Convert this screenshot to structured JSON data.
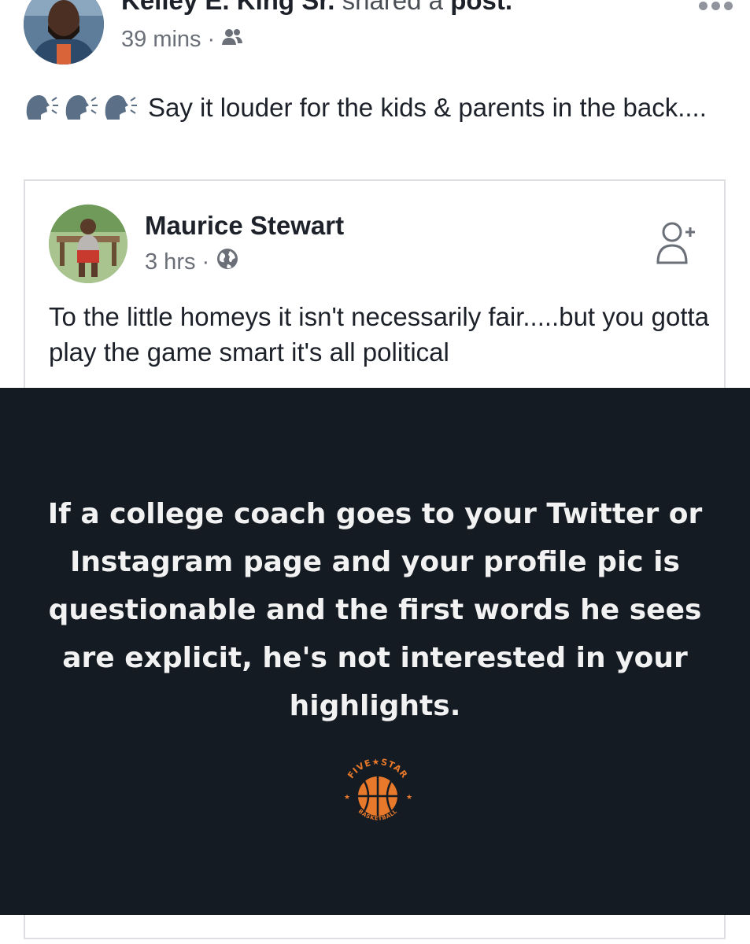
{
  "outer_post": {
    "author": "Kelley E. King Sr.",
    "verb": " shared a ",
    "object": "post.",
    "time": "39 mins",
    "separator": "·",
    "audience_icon": "friends-icon",
    "menu_icon": "more-dots-icon",
    "text": "Say it louder for the kids & parents in the back....",
    "emoji_icon": "speaking-head-icon"
  },
  "shared_post": {
    "author": "Maurice Stewart",
    "time": "3 hrs",
    "separator": "·",
    "audience_icon": "globe-icon",
    "action_icon": "add-friend-icon",
    "text": "To the little homeys it isn't necessarily fair.....but you gotta play the game smart  it's all political"
  },
  "image": {
    "quote": "If a college coach goes to your Twitter or Instagram page and your profile pic is questionable and the first words he sees are explicit, he's not interested in your highlights.",
    "logo_top": "FIVE★STAR",
    "logo_bottom": "BASKETBALL",
    "background": "#141b22",
    "logo_color": "#e8782a"
  }
}
